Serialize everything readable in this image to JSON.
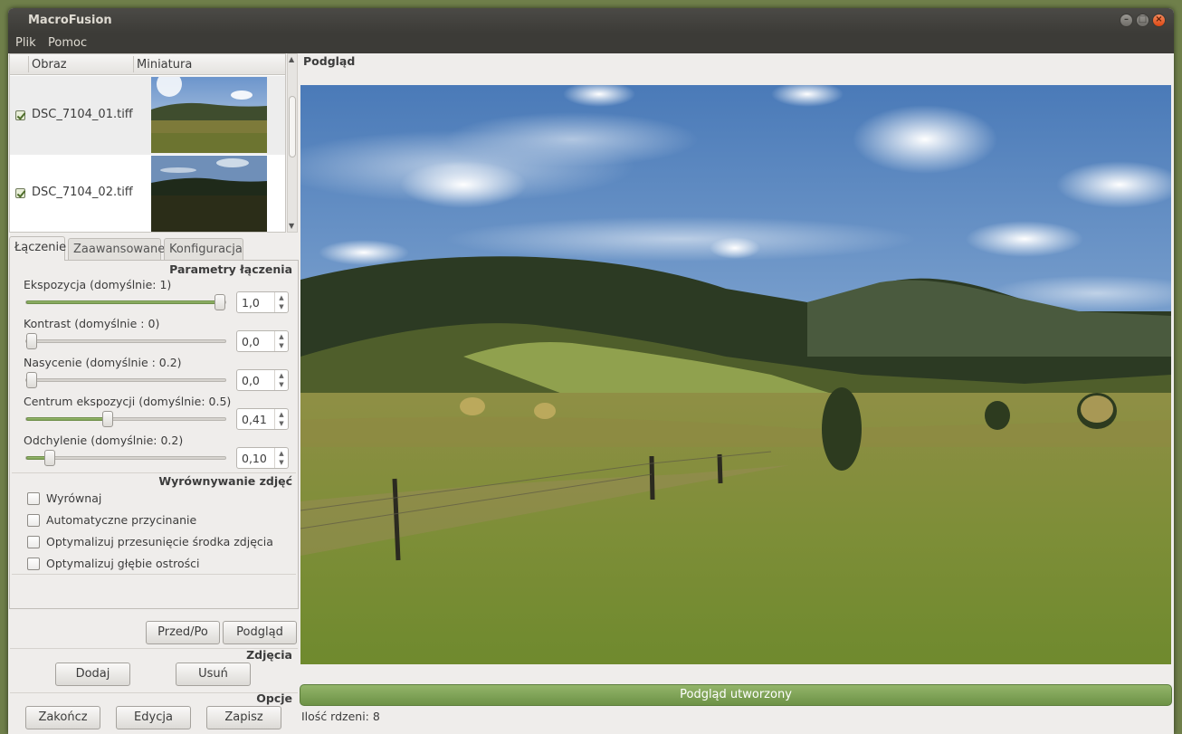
{
  "window": {
    "title": "MacroFusion",
    "controls": {
      "minimize": "–",
      "maximize": "□",
      "close": "×"
    }
  },
  "menu": [
    "Plik",
    "Pomoc"
  ],
  "image_list": {
    "columns": [
      "Obraz",
      "Miniatura"
    ],
    "rows": [
      {
        "checked": true,
        "filename": "DSC_7104_01.tiff"
      },
      {
        "checked": true,
        "filename": "DSC_7104_02.tiff"
      }
    ]
  },
  "tabs": [
    {
      "label": "Łączenie",
      "active": true
    },
    {
      "label": "Zaawansowane",
      "active": false
    },
    {
      "label": "Konfiguracja",
      "active": false
    }
  ],
  "fusion": {
    "group_title": "Parametry łączenia",
    "params": [
      {
        "label": "Ekspozycja (domyślnie: 1)",
        "value": "1,0",
        "level": 1.0
      },
      {
        "label": "Kontrast (domyślnie : 0)",
        "value": "0,0",
        "level": 0.0
      },
      {
        "label": "Nasycenie (domyślnie : 0.2)",
        "value": "0,0",
        "level": 0.0
      },
      {
        "label": "Centrum ekspozycji (domyślnie: 0.5)",
        "value": "0,41",
        "level": 0.41
      },
      {
        "label": "Odchylenie (domyślnie: 0.2)",
        "value": "0,10",
        "level": 0.1
      }
    ]
  },
  "alignment": {
    "group_title": "Wyrównywanie zdjęć",
    "options": [
      {
        "label": "Wyrównaj",
        "checked": false
      },
      {
        "label": "Automatyczne przycinanie",
        "checked": false
      },
      {
        "label": "Optymalizuj przesunięcie środka zdjęcia",
        "checked": false
      },
      {
        "label": "Optymalizuj głębie ostrości",
        "checked": false
      }
    ]
  },
  "buttons": {
    "before_after": "Przed/Po",
    "preview": "Podgląd",
    "photos_section": "Zdjęcia",
    "add": "Dodaj",
    "remove": "Usuń",
    "options_section": "Opcje",
    "quit": "Zakończ",
    "edit": "Edycja",
    "save": "Zapisz"
  },
  "preview": {
    "title": "Podgląd",
    "progress_text": "Podgląd utworzony",
    "progress": 1.0,
    "status": "Ilość rdzeni: 8"
  },
  "colors": {
    "accent_green": "#7a9e52",
    "titlebar": "#3c3b37",
    "window_bg": "#efedeb"
  }
}
